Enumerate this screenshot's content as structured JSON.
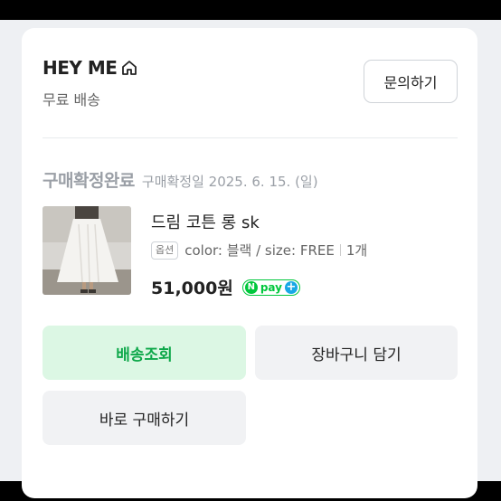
{
  "store": {
    "name": "HEY ME",
    "shipping": "무료 배송",
    "inquiry_label": "문의하기"
  },
  "order": {
    "status": "구매확정완료",
    "confirm_date": "구매확정일 2025. 6. 15. (일)"
  },
  "product": {
    "name": "드림 코튼 롱 sk",
    "option_badge": "옵션",
    "option_text": "color: 블랙 / size: FREE",
    "quantity": "1개",
    "price": "51,000원",
    "npay_n": "N",
    "npay_text": "pay",
    "npay_plus": "+"
  },
  "actions": {
    "track_label": "배송조회",
    "cart_label": "장바구니 담기",
    "buy_label": "바로 구매하기"
  },
  "colors": {
    "accent_green": "#0ea84a",
    "track_bg": "#dcf7e4",
    "npay_green": "#00c73c",
    "npay_blue": "#18a8e6"
  }
}
